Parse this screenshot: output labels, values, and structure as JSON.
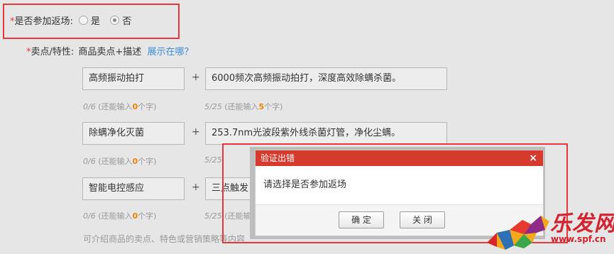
{
  "return_field": {
    "star": "*",
    "label": "是否参加返场:",
    "options": [
      {
        "label": "是",
        "selected": false
      },
      {
        "label": "否",
        "selected": true
      }
    ]
  },
  "selling_points": {
    "star": "*",
    "label": "卖点/特性:",
    "sublabel": "商品卖点+描述",
    "help_link": "展示在哪？",
    "rows": [
      {
        "point": "高频振动拍打",
        "plus": "+",
        "desc": "6000频次高频振动拍打，深度高效除螨杀菌。",
        "point_hint": {
          "count": "0/6",
          "pre": "(还能输入",
          "remaining": "0",
          "post": "个字)"
        },
        "desc_hint": {
          "count": "5/25",
          "pre": "(还能输入",
          "remaining": "5",
          "post": "个字)"
        }
      },
      {
        "point": "除螨净化灭菌",
        "plus": "+",
        "desc": "253.7nm光波段紫外线杀菌灯管，净化尘螨。",
        "point_hint": {
          "count": "0/6",
          "pre": "(还能输入",
          "remaining": "0",
          "post": "个字)"
        },
        "desc_hint": {
          "count": "5/25",
          "pre": "(还能输入",
          "remaining": "",
          "post": ""
        }
      },
      {
        "point": "智能电控感应",
        "plus": "+",
        "desc": "三点触发",
        "point_hint": {
          "count": "0/6",
          "pre": "(还能输入",
          "remaining": "0",
          "post": "个字)"
        },
        "desc_hint": {
          "count": "5/25",
          "pre": "(还能输",
          "remaining": "",
          "post": ""
        }
      }
    ],
    "footer_note": "可介绍商品的卖点、特色或营销策略等内容"
  },
  "modal": {
    "title": "验证出错",
    "close": "×",
    "message": "请选择是否参加返场",
    "confirm": "确 定",
    "cancel": "关 闭"
  },
  "watermark": {
    "text": "乐发网",
    "url": "www.spf.cn"
  },
  "colors": {
    "accent_red": "#e4393c",
    "modal_header": "#d53a2c",
    "link_blue": "#3c8dd9",
    "hint_orange": "#f08300"
  }
}
